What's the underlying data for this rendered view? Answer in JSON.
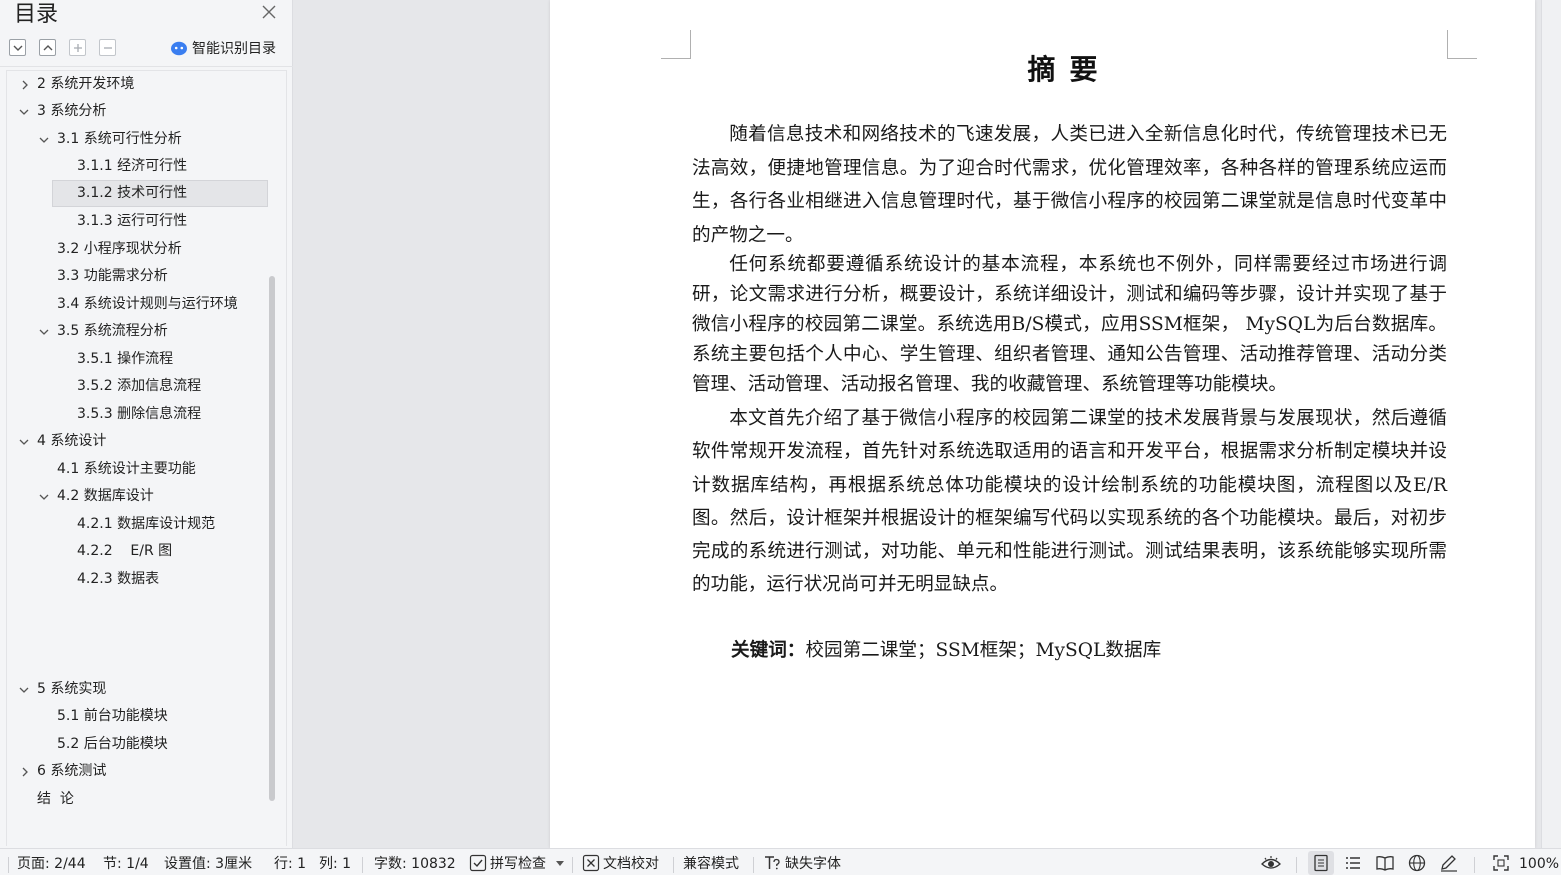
{
  "sidebar": {
    "title": "目录",
    "smart_toc_label": "智能识别目录",
    "toc": [
      {
        "label": "2  系统开发环境"
      },
      {
        "label": "3  系统分析"
      },
      {
        "label": "3.1  系统可行性分析"
      },
      {
        "label": "3.1.1  经济可行性"
      },
      {
        "label": "3.1.2  技术可行性"
      },
      {
        "label": "3.1.3  运行可行性"
      },
      {
        "label": "3.2  小程序现状分析"
      },
      {
        "label": "3.3  功能需求分析"
      },
      {
        "label": "3.4  系统设计规则与运行环境"
      },
      {
        "label": "3.5 系统流程分析"
      },
      {
        "label": "3.5.1 操作流程"
      },
      {
        "label": "3.5.2 添加信息流程"
      },
      {
        "label": "3.5.3 删除信息流程"
      },
      {
        "label": "4  系统设计"
      },
      {
        "label": "4.1  系统设计主要功能"
      },
      {
        "label": "4.2  数据库设计"
      },
      {
        "label": "4.2.1  数据库设计规范"
      },
      {
        "label": "4.2.2    E/R 图"
      },
      {
        "label": "4.2.3  数据表"
      },
      {
        "label": "5  系统实现"
      },
      {
        "label": "5.1 前台功能模块"
      },
      {
        "label": "5.2 后台功能模块"
      },
      {
        "label": "6  系统测试"
      },
      {
        "label": "结  论"
      }
    ]
  },
  "document": {
    "title": "摘要",
    "paragraphs": [
      "随着信息技术和网络技术的飞速发展，人类已进入全新信息化时代，传统管理技术已无法高效，便捷地管理信息。为了迎合时代需求，优化管理效率，各种各样的管理系统应运而生，各行各业相继进入信息管理时代，基于微信小程序的校园第二课堂就是信息时代变革中的产物之一。",
      "任何系统都要遵循系统设计的基本流程，本系统也不例外，同样需要经过市场进行调研，论文需求进行分析，概要设计，系统详细设计，测试和编码等步骤，设计并实现了基于微信小程序的校园第二课堂。系统选用B/S模式，应用SSM框架， MySQL为后台数据库。系统主要包括个人中心、学生管理、组织者管理、通知公告管理、活动推荐管理、活动分类管理、活动管理、活动报名管理、我的收藏管理、系统管理等功能模块。",
      "本文首先介绍了基于微信小程序的校园第二课堂的技术发展背景与发展现状，然后遵循软件常规开发流程，首先针对系统选取适用的语言和开发平台，根据需求分析制定模块并设计数据库结构，再根据系统总体功能模块的设计绘制系统的功能模块图，流程图以及E/R图。然后，设计框架并根据设计的框架编写代码以实现系统的各个功能模块。最后，对初步完成的系统进行测试，对功能、单元和性能进行测试。测试结果表明，该系统能够实现所需的功能，运行状况尚可并无明显缺点。"
    ],
    "keywords_label": "关键词：",
    "keywords": "校园第二课堂；SSM框架；MySQL数据库"
  },
  "statusbar": {
    "page": "页面: 2/44",
    "section": "节: 1/4",
    "setting": "设置值: 3厘米",
    "row": "行: 1",
    "col": "列: 1",
    "words": "字数: 10832",
    "spell": "拼写检查",
    "proof": "文档校对",
    "compat": "兼容模式",
    "missing_font": "缺失字体",
    "zoom": "100%"
  },
  "colors": {
    "accent": "#3a7ef0",
    "selected_bg": "#e4e5e8"
  }
}
